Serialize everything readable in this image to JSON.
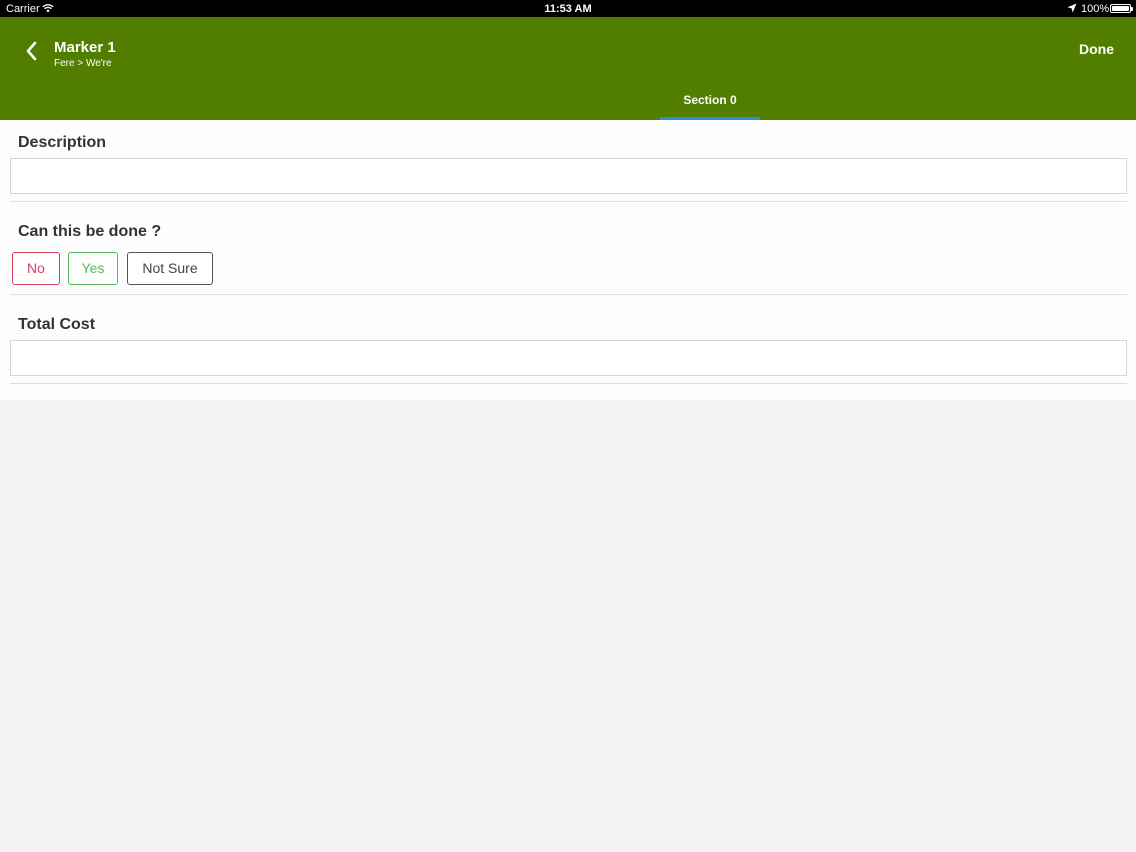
{
  "status_bar": {
    "carrier": "Carrier",
    "time": "11:53 AM",
    "battery": "100%"
  },
  "header": {
    "title": "Marker 1",
    "breadcrumb": "Fere > We're",
    "done_label": "Done",
    "tab_label": "Section 0",
    "background_color": "#527e00",
    "tab_indicator_color": "#2e8fd9"
  },
  "form": {
    "description": {
      "label": "Description",
      "value": "",
      "placeholder": ""
    },
    "can_be_done": {
      "label": "Can this be done ?",
      "options": [
        "No",
        "Yes",
        "Not Sure"
      ],
      "colors": {
        "no": "#d43f5c",
        "yes": "#5cb85c",
        "not_sure": "#555555"
      }
    },
    "total_cost": {
      "label": "Total Cost",
      "value": "",
      "placeholder": ""
    }
  }
}
